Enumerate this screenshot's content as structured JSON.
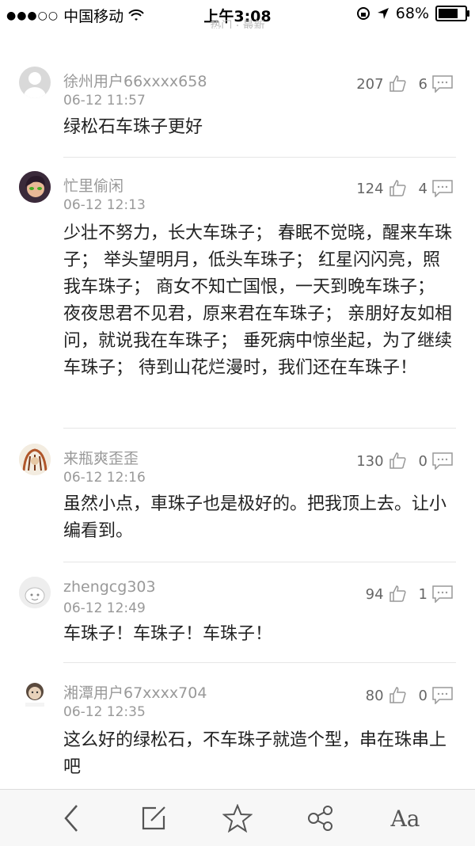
{
  "status": {
    "carrier": "中国移动",
    "time": "上午3:08",
    "battery": "68%"
  },
  "hint": "热门 · 最新",
  "comments": [
    {
      "user": "徐州用户66xxxx658",
      "time": "06-12 11:57",
      "likes": "207",
      "replies": "6",
      "text": "绿松石车珠子更好"
    },
    {
      "user": "忙里偷闲",
      "time": "06-12 12:13",
      "likes": "124",
      "replies": "4",
      "text": "少壮不努力，长大车珠子； 春眠不觉晓，醒来车珠子； 举头望明月，低头车珠子； 红星闪闪亮，照我车珠子； 商女不知亡国恨，一天到晚车珠子； 夜夜思君不见君，原来君在车珠子； 亲朋好友如相问，就说我在车珠子； 垂死病中惊坐起，为了继续车珠子； 待到山花烂漫时，我们还在车珠子！"
    },
    {
      "user": "来瓶爽歪歪",
      "time": "06-12 12:16",
      "likes": "130",
      "replies": "0",
      "text": "虽然小点，車珠子也是极好的。把我顶上去。让小编看到。"
    },
    {
      "user": "zhengcg303",
      "time": "06-12 12:49",
      "likes": "94",
      "replies": "1",
      "text": "车珠子！车珠子！车珠子！"
    },
    {
      "user": "湘潭用户67xxxx704",
      "time": "06-12 12:35",
      "likes": "80",
      "replies": "0",
      "text": "这么好的绿松石，不车珠子就造个型，串在珠串上吧"
    }
  ],
  "toolbar": {
    "back": "back-icon",
    "write": "edit-icon",
    "favorite": "star-icon",
    "share": "share-icon",
    "font": "Aa"
  }
}
